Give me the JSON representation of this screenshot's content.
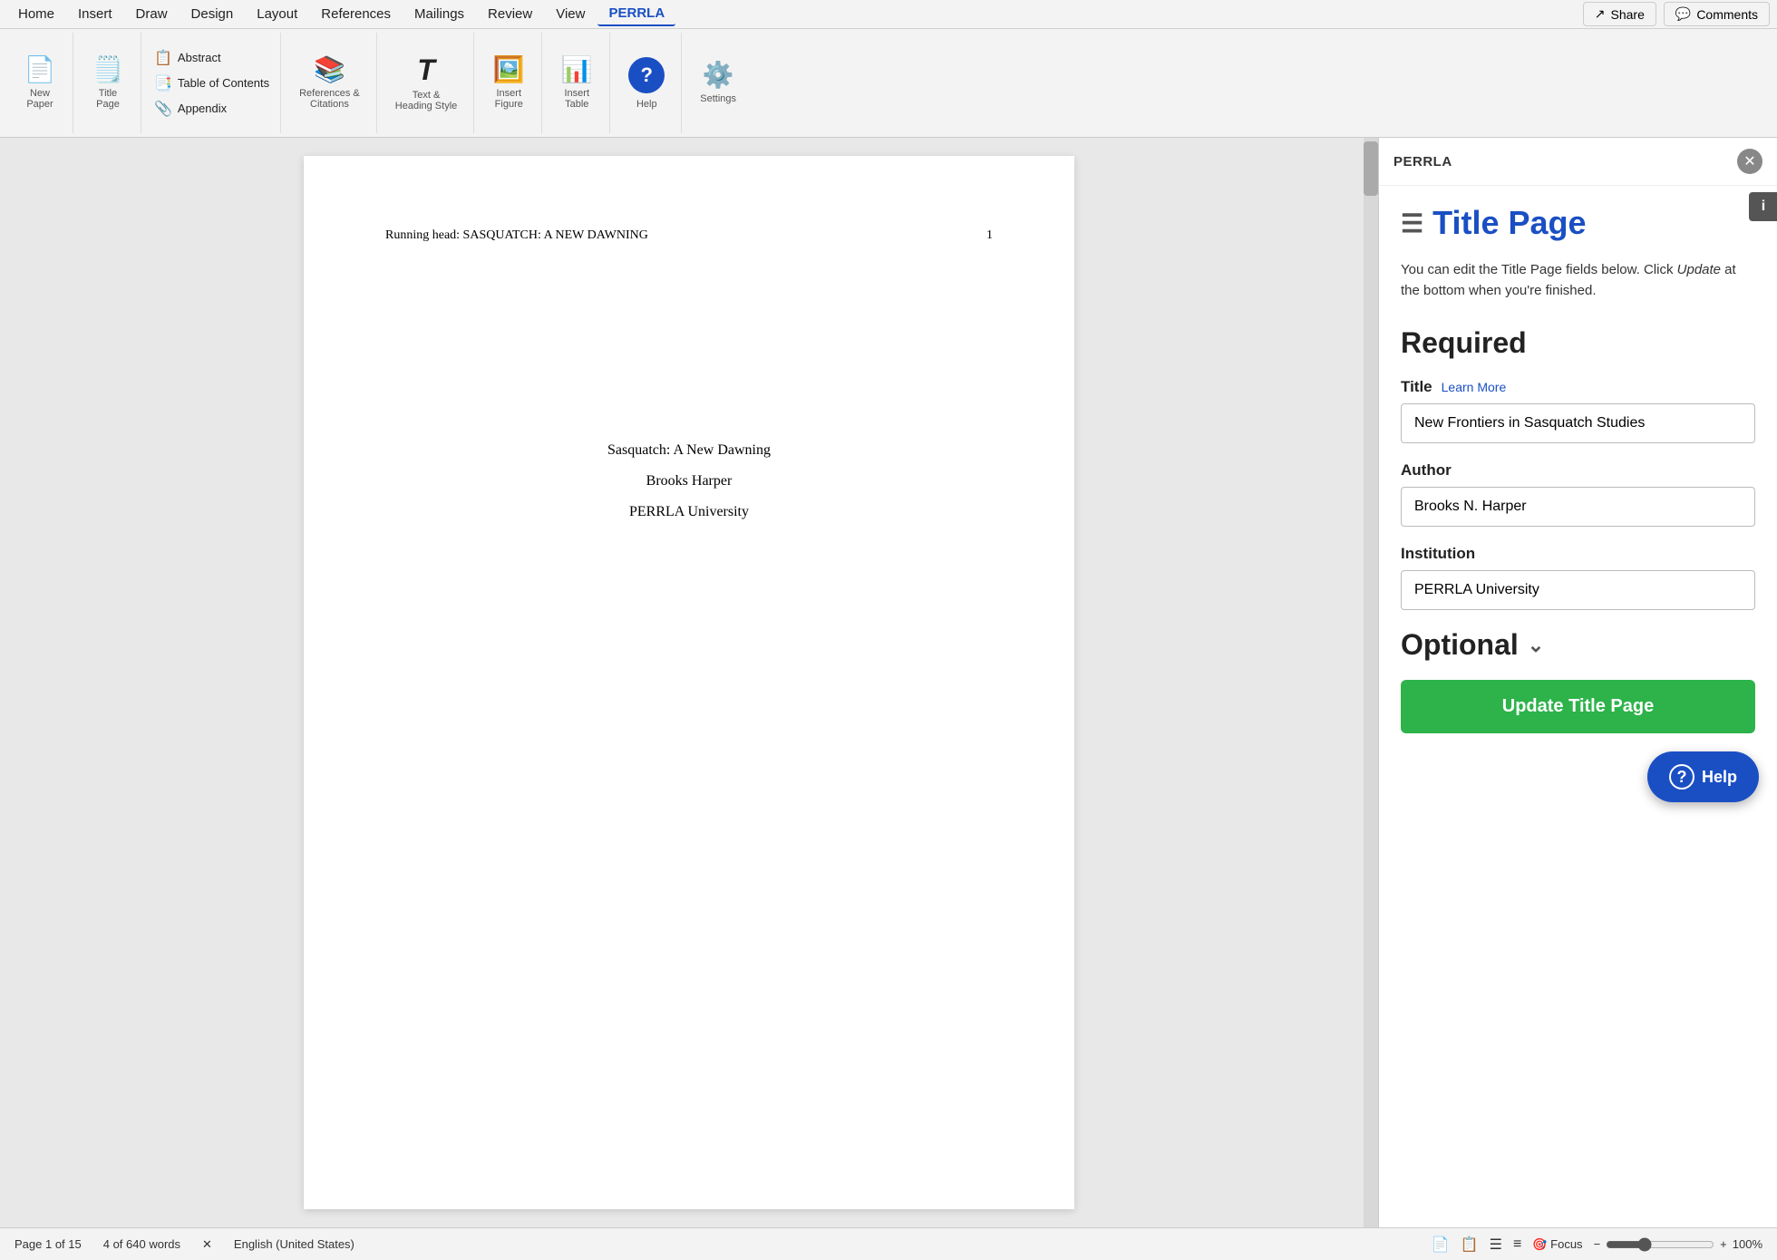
{
  "menu": {
    "items": [
      "Home",
      "Insert",
      "Draw",
      "Design",
      "Layout",
      "References",
      "Mailings",
      "Review",
      "View",
      "PERRLA"
    ],
    "active": "PERRLA",
    "share_label": "Share",
    "comments_label": "Comments"
  },
  "ribbon": {
    "new_paper_label": "New\nPaper",
    "title_page_label": "Title\nPage",
    "abstract_label": "Abstract",
    "table_of_contents_label": "Table of Contents",
    "appendix_label": "Appendix",
    "references_citations_label": "References &\nCitations",
    "text_heading_style_label": "Text &\nHeading Style",
    "insert_figure_label": "Insert\nFigure",
    "insert_table_label": "Insert\nTable",
    "help_label": "Help",
    "settings_label": "Settings"
  },
  "document": {
    "running_head": "Running head: SASQUATCH: A NEW DAWNING",
    "page_number": "1",
    "title": "Sasquatch: A New Dawning",
    "author": "Brooks Harper",
    "institution": "PERRLA University"
  },
  "status_bar": {
    "page_info": "Page 1 of 15",
    "word_count": "4 of 640 words",
    "language": "English (United States)",
    "focus_label": "Focus",
    "zoom_percent": "100%"
  },
  "panel": {
    "header_title": "PERRLA",
    "section_title": "Title Page",
    "description_part1": "You can edit the Title Page fields below. Click ",
    "description_italic": "Update",
    "description_part2": " at the bottom when you're finished.",
    "required_heading": "Required",
    "title_label": "Title",
    "learn_more_label": "Learn More",
    "title_value": "New Frontiers in Sasquatch Studies",
    "author_label": "Author",
    "author_value": "Brooks N. Harper",
    "institution_label": "Institution",
    "institution_value": "PERRLA University",
    "optional_heading": "Optional",
    "update_button_label": "Update Title Page",
    "help_button_label": "Help",
    "close_icon": "✕",
    "info_icon": "i"
  }
}
